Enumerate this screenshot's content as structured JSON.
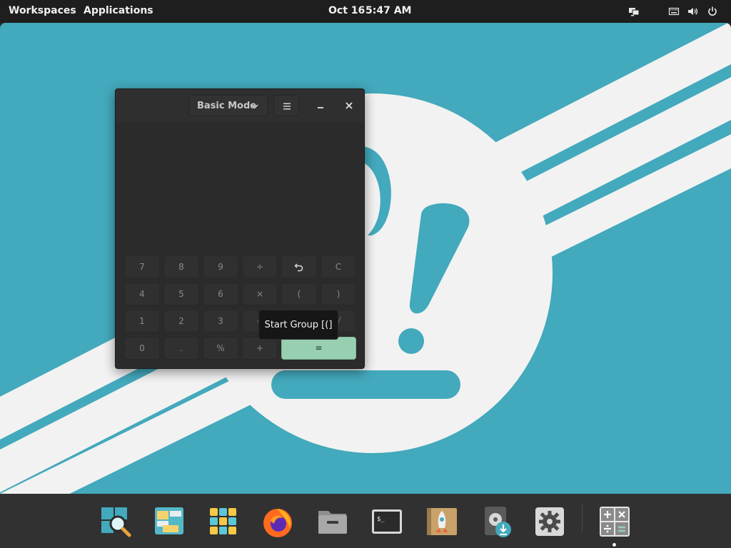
{
  "topbar": {
    "workspaces_label": "Workspaces",
    "applications_label": "Applications",
    "date": "Oct 16",
    "time": "5:47 AM",
    "status_icons": [
      "display-icon",
      "keyboard-icon",
      "volume-icon",
      "power-icon"
    ]
  },
  "calculator": {
    "mode_label": "Basic Mode",
    "menu_icon": "hamburger-menu-icon",
    "minimize_icon": "minimize-icon",
    "close_icon": "close-icon",
    "keys": [
      [
        "7",
        "8",
        "9",
        "÷",
        "↶",
        "C"
      ],
      [
        "4",
        "5",
        "6",
        "×",
        "(",
        ")"
      ],
      [
        "1",
        "2",
        "3",
        "−",
        "x²",
        "√"
      ],
      [
        "0",
        ".",
        "%",
        "+",
        "="
      ]
    ],
    "equals_color": "#97cfb0"
  },
  "tooltip": {
    "text": "Start Group [(]"
  },
  "dock": {
    "apps": [
      "search-icon",
      "workspaces-icon",
      "applications-grid-icon",
      "firefox-icon",
      "files-icon",
      "terminal-icon",
      "installer-icon",
      "software-updater-icon",
      "settings-icon",
      "calculator-icon"
    ],
    "running_app": "calculator-icon"
  },
  "colors": {
    "wallpaper": "#43a9bc",
    "accent": "#97cfb0",
    "panel": "#1e1e1e",
    "dock": "#313131"
  }
}
